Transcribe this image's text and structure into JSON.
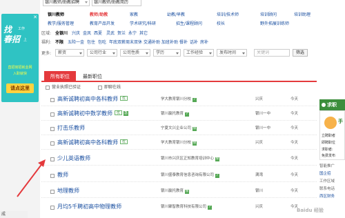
{
  "ad": {
    "close": "✕",
    "big_line1": "找",
    "big_line2": "春招",
    "small1": "工作",
    "small2": "上",
    "line1": "直招官招就业网",
    "line2": "入职就快",
    "button": "请点这里"
  },
  "top_tabs": [
    {
      "label": "银川教师/助教招聘"
    },
    {
      "label": "银川教师/助教简历"
    }
  ],
  "category_row1": {
    "items": [
      "银川教师",
      "教师/助教",
      "家教",
      "幼教/早教",
      "培训/技术师",
      "培训顾问",
      "培训助理"
    ]
  },
  "category_row2": {
    "items": [
      "教学/服务管理",
      "教育产品开发",
      "学术研究/科研",
      "招生/课程顾问",
      "校长",
      "野外拓展训练师"
    ]
  },
  "region": {
    "label": "区域:",
    "items": [
      "全银川",
      "兴庆",
      "金凤",
      "西夏",
      "灵武",
      "贺兰",
      "永宁",
      "其它"
    ]
  },
  "benefits": {
    "label": "福利:",
    "items": [
      "不限",
      "五险一金",
      "包住",
      "包吃",
      "年底双薪",
      "周末双休",
      "交通补助",
      "加班补助",
      "餐补",
      "话补",
      "房补"
    ]
  },
  "more": {
    "label": "更多:",
    "drops": [
      "薪资",
      "公司行业",
      "公司性质",
      "学历",
      "工作经验",
      "发布时间"
    ],
    "keyword_placeholder": "关键词",
    "filter_button": "筛选"
  },
  "job_tabs": {
    "active": "所有职位",
    "other": "最新职位"
  },
  "options": {
    "license": "营业执照已验证",
    "online": "即聊在线"
  },
  "jobs": [
    {
      "title": "高新诚聘初高中各科教师",
      "badge": "优",
      "green": "",
      "company": "学大教育银川分校",
      "cbadge": "",
      "location": "兴庆",
      "date": "今天"
    },
    {
      "title": "高新诚聘初中数学教师",
      "badge": "优",
      "green": "急",
      "company": "银川赢托教育",
      "cbadge": "",
      "location": "银川一中",
      "date": "今天"
    },
    {
      "title": "打击乐教师",
      "badge": "",
      "green": "",
      "company": "宁夏文兴企业公司",
      "cbadge": "保",
      "location": "银川一中",
      "date": "今天"
    },
    {
      "title": "高新诚聘初高中各科教师",
      "badge": "优",
      "green": "",
      "company": "学大教育银川分校",
      "cbadge": "保",
      "location": "兴庆",
      "date": "今天"
    },
    {
      "title": "少儿英语教师",
      "badge": "",
      "green": "",
      "company": "银川市兴庆区正知教育培训中心",
      "cbadge": "保",
      "location": "",
      "date": "今天"
    },
    {
      "title": "教师",
      "badge": "",
      "green": "",
      "company": "银川盛泰教育信息咨询有限公司",
      "cbadge": "",
      "location": "满湾",
      "date": "今天"
    },
    {
      "title": "地理教师",
      "badge": "",
      "green": "",
      "company": "银川赢托教育",
      "cbadge": "保",
      "location": "银川",
      "date": "今天"
    },
    {
      "title": "月均5千聘初高中物理教师",
      "badge": "",
      "green": "",
      "company": "银川聚智教育科技有限公司",
      "cbadge": "",
      "location": "兴庆",
      "date": "今天"
    }
  ],
  "right": {
    "header": "求职",
    "icon_char": "手",
    "line1": "立聘职者",
    "line2": "即聘职位",
    "line3": "求职者:",
    "line4": "免费发布",
    "section": "智能推广",
    "links": [
      "国企招",
      "工作区域",
      "联系电话",
      "西区财务"
    ]
  },
  "status": "成",
  "watermark": "Baidu 经验"
}
